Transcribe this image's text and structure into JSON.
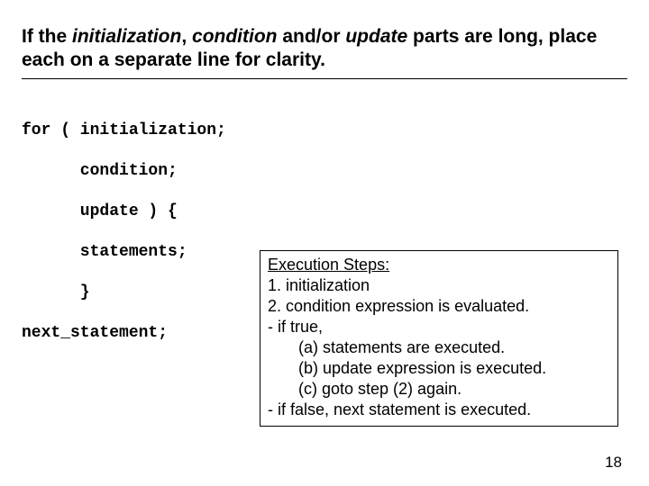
{
  "title": {
    "pre1": "If the ",
    "i1": "initialization",
    "sep1": ", ",
    "i2": "condition",
    "mid": " and/or ",
    "i3": "update",
    "post": " parts are long, place each on a separate line for clarity."
  },
  "code": "for ( initialization;\n\n      condition;\n\n      update ) {\n\n      statements;\n\n      }\n\nnext_statement;",
  "exec": {
    "heading": "Execution Steps:",
    "l1": "1. initialization",
    "l2": "2. condition expression is evaluated.",
    "l3": "- if true,",
    "l4": "(a) statements are executed.",
    "l5": "(b) update expression is executed.",
    "l6": "(c) goto step (2) again.",
    "l7": "- if false, next statement is executed."
  },
  "page": "18"
}
